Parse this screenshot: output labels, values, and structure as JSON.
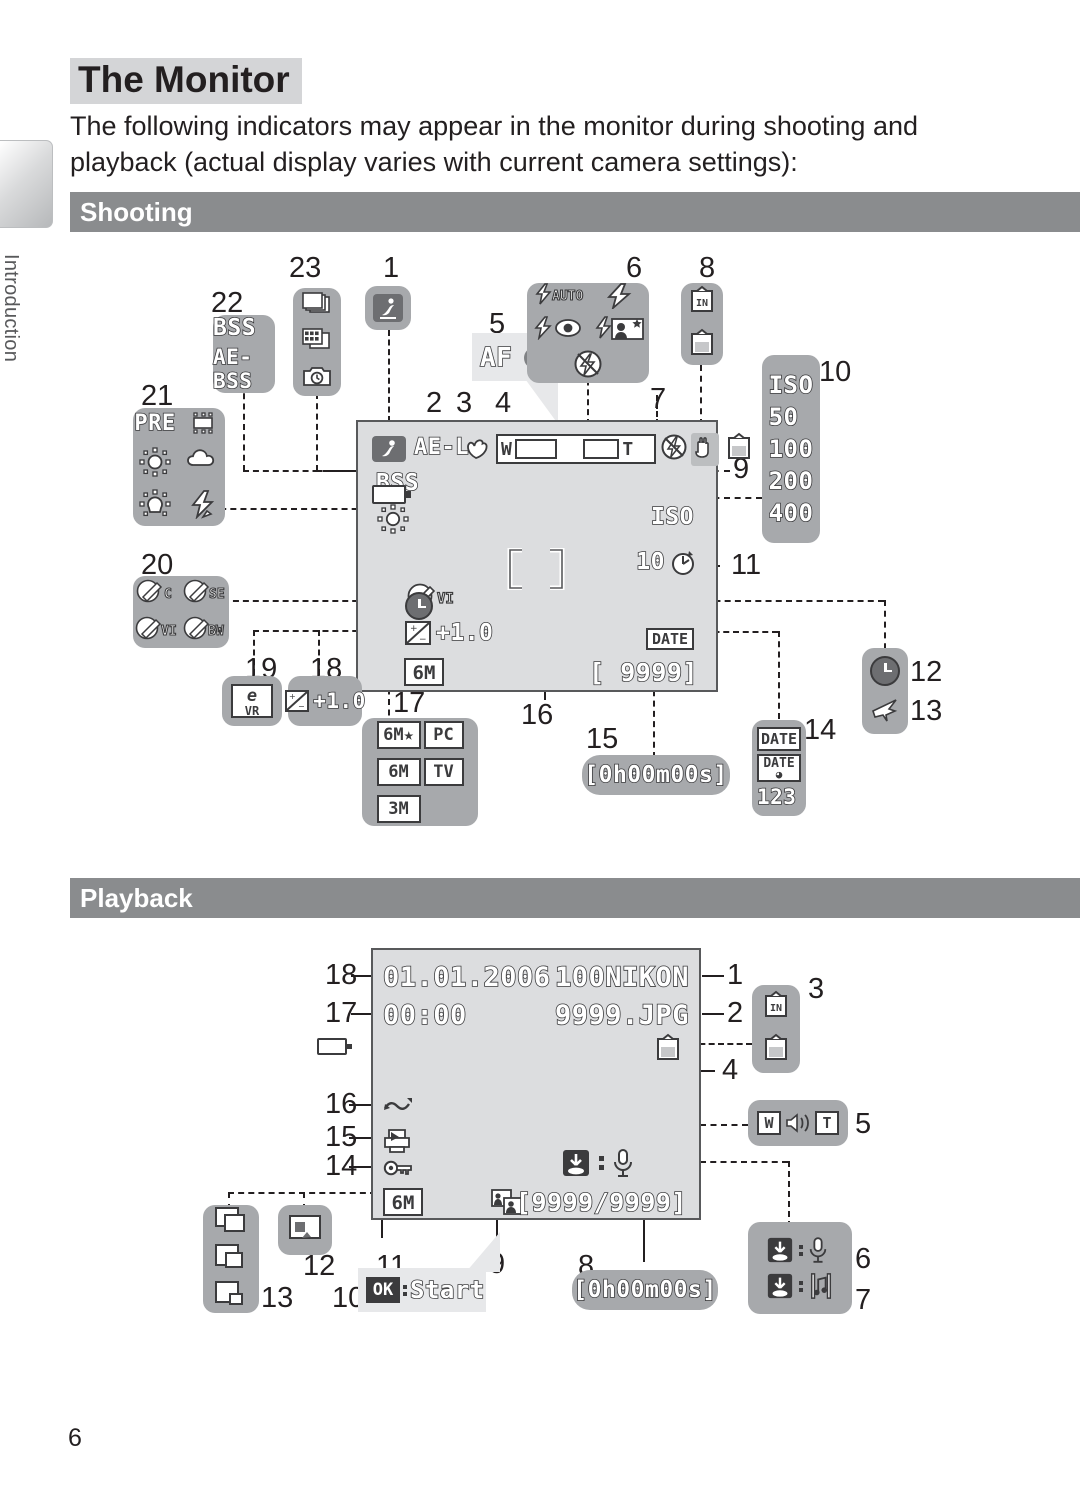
{
  "page": {
    "number": "6",
    "side_label": "Introduction",
    "title": "The Monitor",
    "intro": "The following indicators may appear in the monitor during shooting and playback (actual display varies with current camera settings):"
  },
  "sections": {
    "shooting": {
      "band_label": "Shooting"
    },
    "playback": {
      "band_label": "Playback"
    }
  },
  "shooting": {
    "screen": {
      "mode_icon": "scene-mode-icon",
      "ae_lock": "AE-L",
      "macro_icon": "macro-flower-icon",
      "zoom_wide": "W",
      "zoom_tele": "T",
      "flash_off_icon": "flash-off-icon",
      "camera_shake_icon": "camera-shake-hand-icon",
      "memory_card_icon": "memory-card-icon",
      "bss": "BSS",
      "white_balance_icon": "white-balance-sunny-icon",
      "battery_icon": "battery-icon",
      "iso": "ISO",
      "color_option": "VI",
      "exposure_comp": "+1.0",
      "image_size": "6M",
      "focus_brackets": "focus-area-brackets",
      "self_timer": "10",
      "self_timer_icon": "self-timer-icon",
      "clock_not_set_icon": "clock-not-set-icon",
      "date_imprint": "DATE",
      "frames_remaining": "[ 9999]"
    },
    "callouts": {
      "af_indicator": {
        "number": "5",
        "label": "AF",
        "dot": "focus-dot"
      },
      "flash_modes": {
        "number": "6",
        "items": [
          "flash-auto",
          "flash-fill",
          "flash-redeye",
          "flash-slowsync",
          "flash-off"
        ],
        "auto_label": "AUTO"
      },
      "memory": {
        "number": "8",
        "items": [
          "internal-memory-IN",
          "memory-card"
        ],
        "in_label": "IN"
      },
      "iso_values": {
        "number": "10",
        "items": [
          "ISO",
          "50",
          "100",
          "200",
          "400"
        ]
      },
      "shutter_mode": {
        "number": "1",
        "icon": "scene-mode-icon"
      },
      "continuous": {
        "number": "23",
        "items": [
          "continuous-icon",
          "multishot16-icon",
          "interval-timer-icon"
        ]
      },
      "bss_group": {
        "number": "22",
        "items": [
          "BSS",
          "AE-BSS"
        ]
      },
      "white_balance": {
        "number": "21",
        "items": [
          "PRE",
          "fluorescent",
          "sunny",
          "cloudy",
          "incandescent",
          "flash"
        ]
      },
      "color_options": {
        "number": "20",
        "items": [
          "C",
          "SE",
          "VI",
          "BW"
        ]
      },
      "evr": {
        "number": "19",
        "label": "VR",
        "glyph": "e"
      },
      "exposure": {
        "number": "18",
        "value": "+1.0"
      },
      "image_sizes": {
        "number": "17",
        "items": [
          "6M★",
          "PC",
          "6M",
          "TV",
          "3M"
        ]
      },
      "focus_area": {
        "number": "16"
      },
      "movie_length": {
        "number": "15",
        "value": "[0h00m00s]"
      },
      "date_options": {
        "number": "14",
        "items": [
          "DATE",
          "DATE-TIME",
          "123"
        ]
      },
      "travel": {
        "number": "13",
        "icon": "airplane-icon"
      },
      "clock": {
        "number": "12",
        "icon": "clock-icon"
      },
      "self_timer_num": {
        "number": "11"
      },
      "battery_num": {
        "number": "9"
      },
      "shake_num": {
        "number": "7"
      },
      "zoom_num": {
        "number": "4"
      },
      "macro_num": {
        "number": "3"
      },
      "ae_num": {
        "number": "2"
      }
    }
  },
  "playback": {
    "screen": {
      "date": "01.01.2006",
      "time": "00:00",
      "folder": "100NIKON",
      "filename": "9999.JPG",
      "battery_icon": "battery-icon",
      "card_icon": "memory-card-icon",
      "transfer_icon": "transfer-mark-icon",
      "print_icon": "print-order-icon",
      "protect_icon": "protect-key-icon",
      "image_size": "6M",
      "small_pic_icon": "small-picture-icon",
      "frame_counter": "[9999/9999]",
      "voice_icon": "voice-memo-icon",
      "mic_icon": "microphone-icon"
    },
    "callouts": {
      "folder_num": {
        "number": "1"
      },
      "file_num": {
        "number": "2"
      },
      "memory": {
        "number": "3",
        "items": [
          "internal-memory-IN",
          "memory-card"
        ],
        "in_label": "IN"
      },
      "battery_num": {
        "number": "4"
      },
      "volume": {
        "number": "5",
        "wide": "W",
        "tele": "T",
        "icon": "speaker-icon"
      },
      "voice_record": {
        "number": "6",
        "icon": "microphone-icon"
      },
      "voice_play": {
        "number": "7",
        "icon": "music-note-icon"
      },
      "movie_length": {
        "number": "8",
        "value": "[0h00m00s]"
      },
      "small_pic_num": {
        "number": "9"
      },
      "ok_start": {
        "number": "10",
        "button": "OK",
        "label": "Start"
      },
      "size_num": {
        "number": "11"
      },
      "small_picture": {
        "number": "12",
        "icon": "small-picture-icon"
      },
      "crop_copy": {
        "number": "13",
        "items": [
          "copy-icon",
          "crop-icon",
          "small-pic-icon"
        ]
      },
      "protect_num": {
        "number": "14"
      },
      "print_num": {
        "number": "15"
      },
      "transfer_num": {
        "number": "16"
      },
      "time_num": {
        "number": "17"
      },
      "date_num": {
        "number": "18"
      }
    }
  }
}
